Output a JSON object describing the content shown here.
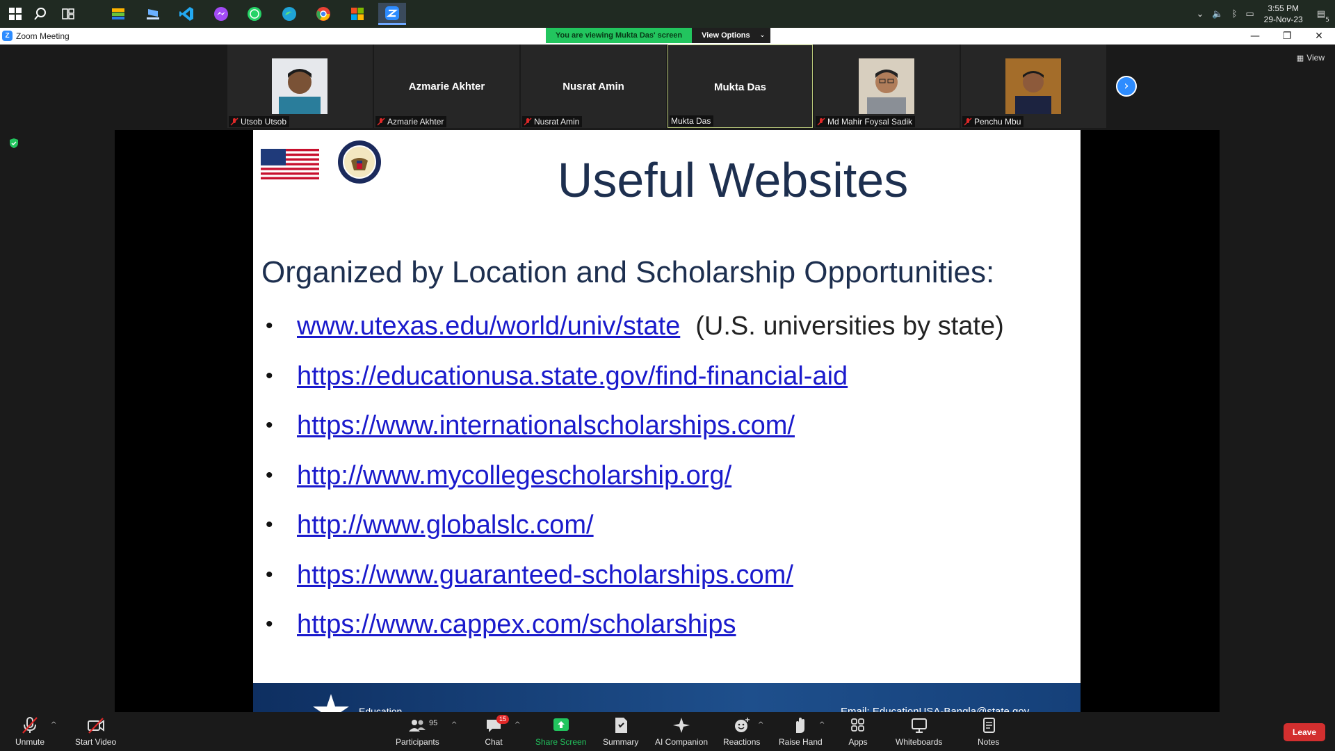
{
  "taskbar": {
    "pinned_apps": [
      "start-icon",
      "search-icon",
      "task-view-icon",
      "bluestacks-icon",
      "laptop-app-icon",
      "vscode-icon",
      "messenger-icon",
      "whatsapp-icon",
      "edge-icon",
      "chrome-icon",
      "store-icon",
      "zoom-icon"
    ],
    "time": "3:55 PM",
    "date": "29-Nov-23",
    "notification_count": "5"
  },
  "window": {
    "title": "Zoom Meeting"
  },
  "banner": {
    "viewing_text": "You are viewing Mukta Das' screen",
    "view_options_label": "View Options"
  },
  "participants": [
    {
      "display_name": "",
      "label": "Utsob Utsob",
      "has_photo": true,
      "muted": true
    },
    {
      "display_name": "Azmarie Akhter",
      "label": "Azmarie Akhter",
      "has_photo": false,
      "muted": true
    },
    {
      "display_name": "Nusrat Amin",
      "label": "Nusrat Amin",
      "has_photo": false,
      "muted": true
    },
    {
      "display_name": "Mukta Das",
      "label": "Mukta Das",
      "has_photo": false,
      "muted": false,
      "active_speaker": true
    },
    {
      "display_name": "",
      "label": "Md Mahir Foysal Sadik",
      "has_photo": true,
      "muted": true
    },
    {
      "display_name": "",
      "label": "Penchu Mbu",
      "has_photo": true,
      "muted": true
    }
  ],
  "view_label": "View",
  "slide": {
    "title": "Useful Websites",
    "subtitle": "Organized by Location and Scholarship Opportunities:",
    "links": [
      {
        "url": "www.utexas.edu/world/univ/state",
        "note": "(U.S. universities by state)"
      },
      {
        "url": "https://educationusa.state.gov/find-financial-aid",
        "note": ""
      },
      {
        "url": "https://www.internationalscholarships.com/",
        "note": ""
      },
      {
        "url": "http://www.mycollegescholarship.org/",
        "note": ""
      },
      {
        "url": "http://www.globalslc.com/",
        "note": ""
      },
      {
        "url": "https://www.guaranteed-scholarships.com/",
        "note": ""
      },
      {
        "url": "https://www.cappex.com/scholarships",
        "note": ""
      }
    ],
    "footer_left": "Education",
    "footer_right": "Email: EducationUSA-Bangla@state.gov"
  },
  "toolbar": {
    "unmute": "Unmute",
    "start_video": "Start Video",
    "participants": "Participants",
    "participants_count": "95",
    "chat": "Chat",
    "chat_badge": "15",
    "share_screen": "Share Screen",
    "summary": "Summary",
    "ai_companion": "AI Companion",
    "reactions": "Reactions",
    "raise_hand": "Raise Hand",
    "apps": "Apps",
    "whiteboards": "Whiteboards",
    "notes": "Notes",
    "leave": "Leave"
  },
  "colors": {
    "zoom_blue": "#2d8cff",
    "share_green": "#22c55e",
    "leave_red": "#d32f2f",
    "slide_navy": "#1d2f4f",
    "link_blue": "#1a1acc"
  }
}
